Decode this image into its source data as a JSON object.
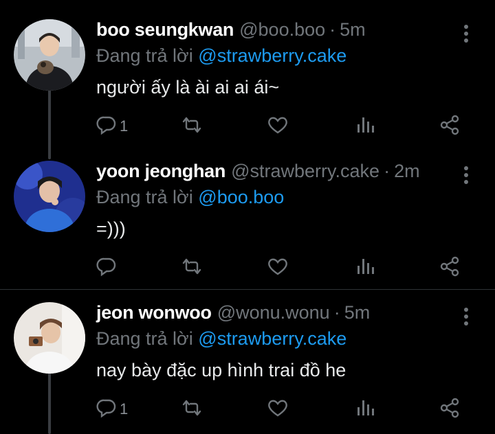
{
  "tweets": [
    {
      "name": "boo seungkwan",
      "handle": "@boo.boo",
      "separator": "·",
      "time": "5m",
      "replying_prefix": "Đang trả lời",
      "replying_to": "@strawberry.cake",
      "text": "người ấy là ài ai ai ái~",
      "reply_count": "1",
      "avatar": {
        "bg": "#b9c0c6",
        "accent": "#1b1c20"
      }
    },
    {
      "name": "yoon jeonghan",
      "handle": "@strawberry.cake",
      "separator": "·",
      "time": "2m",
      "replying_prefix": "Đang trả lời",
      "replying_to": "@boo.boo",
      "text": "=)))",
      "reply_count": "",
      "avatar": {
        "bg": "#2a3fae",
        "accent": "#1a237e"
      }
    },
    {
      "name": "jeon wonwoo",
      "handle": "@wonu.wonu",
      "separator": "·",
      "time": "5m",
      "replying_prefix": "Đang trả lời",
      "replying_to": "@strawberry.cake",
      "text": "nay bày đặc up hình trai đồ he",
      "reply_count": "1",
      "avatar": {
        "bg": "#e8e4df",
        "accent": "#8a5a3a"
      }
    }
  ],
  "colors": {
    "background": "#000000",
    "muted": "#71767b",
    "link": "#1d9bf0",
    "thread_line": "#3a3d42",
    "divider": "#2f3336"
  },
  "icons": [
    "reply-icon",
    "retweet-icon",
    "like-icon",
    "views-icon",
    "share-icon",
    "more-icon"
  ]
}
